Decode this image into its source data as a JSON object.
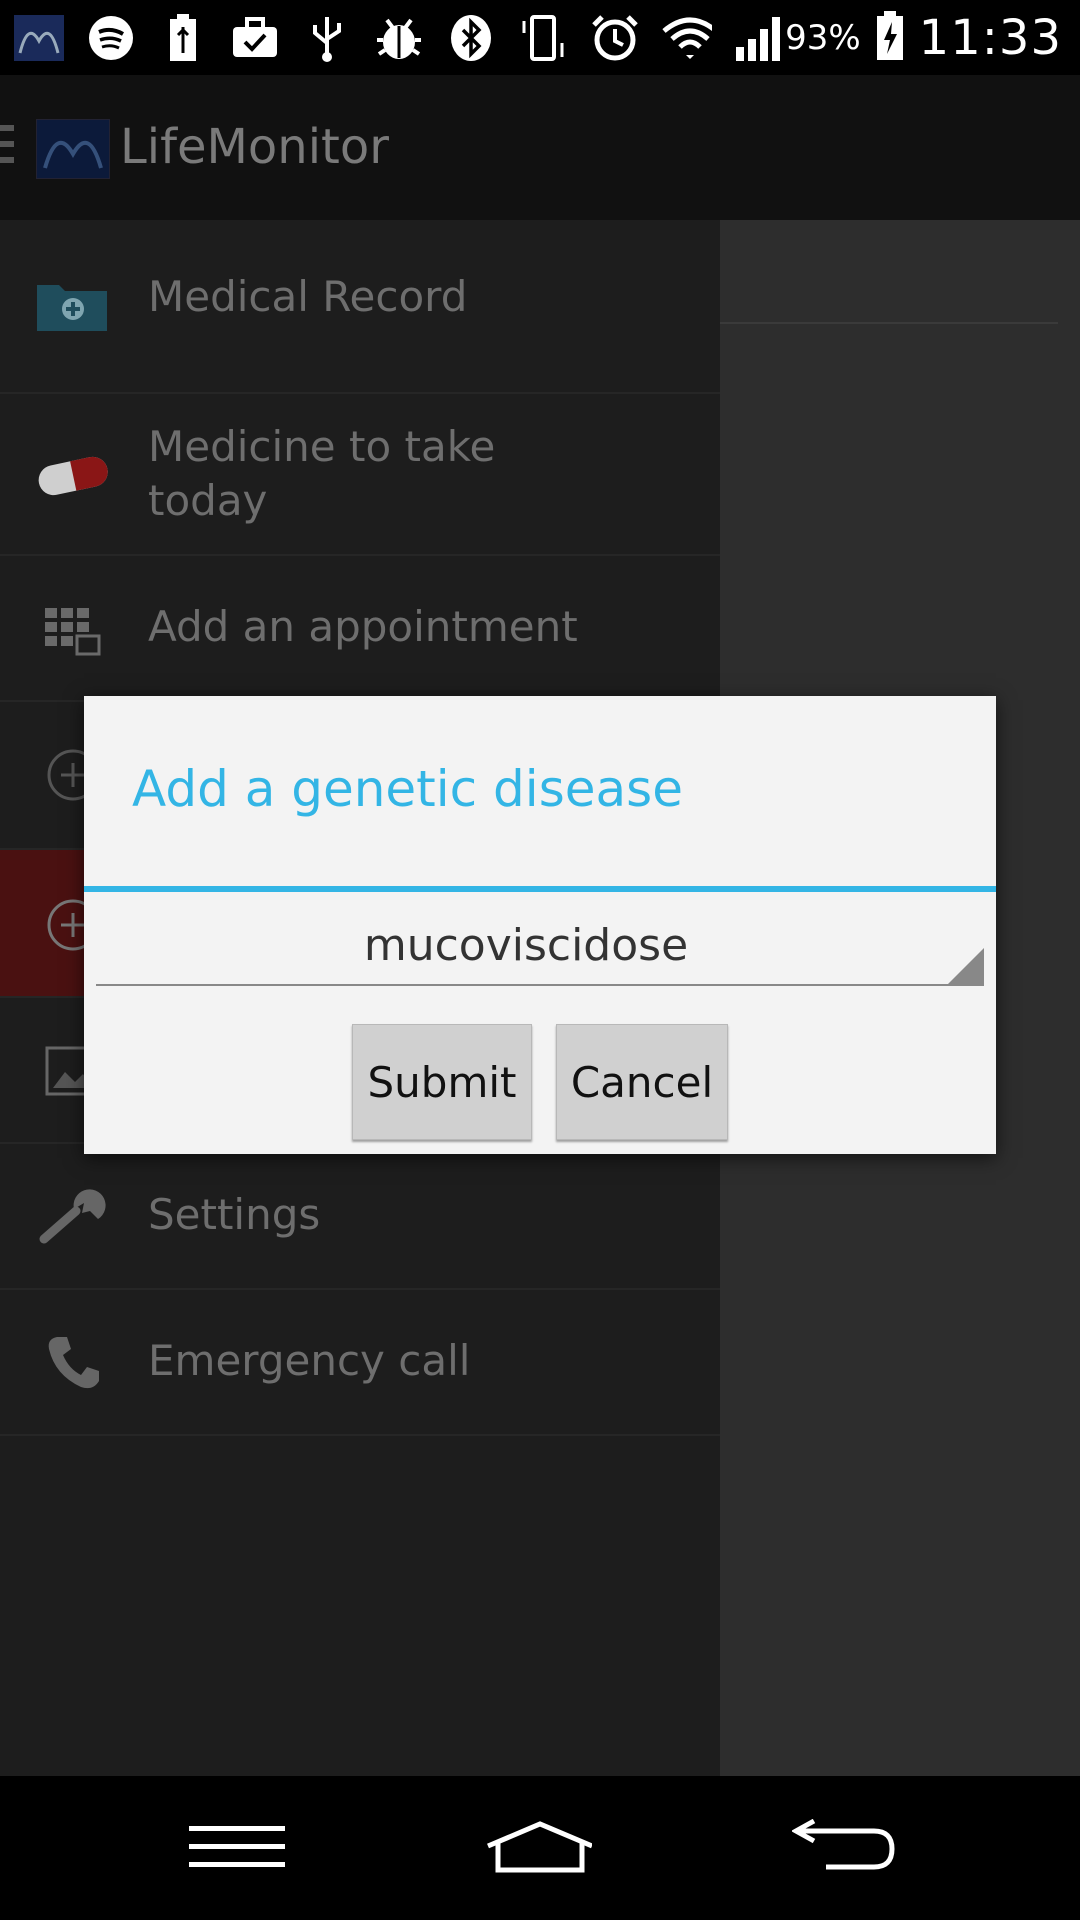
{
  "status_bar": {
    "icons": [
      "lifemonitor-app-icon",
      "spotify-icon",
      "usb-battery-icon",
      "briefcase-check-icon",
      "usb-icon",
      "debug-bug-icon",
      "bluetooth-icon",
      "vibrate-icon",
      "alarm-icon",
      "wifi-icon",
      "signal-icon",
      "battery-charging-icon"
    ],
    "battery_percent": "93%",
    "time": "11:33"
  },
  "app_bar": {
    "title": "LifeMonitor"
  },
  "drawer": {
    "items": [
      {
        "label": "Medical Record",
        "icon": "medical-folder-icon"
      },
      {
        "label": "Medicine to take today",
        "icon": "pill-icon"
      },
      {
        "label": "Add an appointment",
        "icon": "calendar-icon"
      },
      {
        "label": "",
        "icon": "add-circle-icon"
      },
      {
        "label": "",
        "icon": "add-circle-icon"
      },
      {
        "label": "",
        "icon": "picture-icon"
      },
      {
        "label": "Settings",
        "icon": "wrench-icon"
      },
      {
        "label": "Emergency call",
        "icon": "phone-icon"
      }
    ]
  },
  "dialog": {
    "title": "Add a genetic disease",
    "selected_value": "mucoviscidose",
    "submit_label": "Submit",
    "cancel_label": "Cancel"
  },
  "colors": {
    "accent": "#33b5e5",
    "drawer_bg": "#1d1d1d",
    "active_item": "#4a1111"
  }
}
